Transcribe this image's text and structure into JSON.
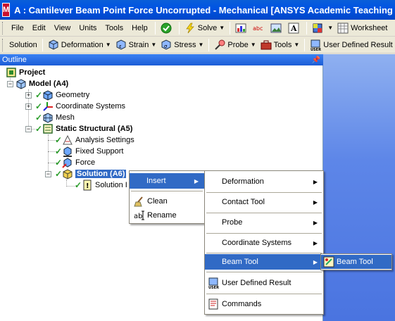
{
  "window": {
    "title": "A : Cantilever Beam Point Force Uncorrupted - Mechanical [ANSYS Academic Teaching A",
    "app_icon_letter": "M"
  },
  "menubar": {
    "items": [
      "File",
      "Edit",
      "View",
      "Units",
      "Tools",
      "Help"
    ],
    "solve_label": "Solve",
    "worksheet_label": "Worksheet"
  },
  "context_toolbar": {
    "solution_label": "Solution",
    "deformation_label": "Deformation",
    "strain_label": "Strain",
    "stress_label": "Stress",
    "probe_label": "Probe",
    "tools_label": "Tools",
    "user_defined_label": "User Defined Result"
  },
  "outline": {
    "header": "Outline",
    "project": "Project",
    "model": "Model (A4)",
    "geometry": "Geometry",
    "coordinate_systems": "Coordinate Systems",
    "mesh": "Mesh",
    "static_structural": "Static Structural (A5)",
    "analysis_settings": "Analysis Settings",
    "fixed_support": "Fixed Support",
    "force": "Force",
    "solution": "Solution (A6)",
    "solution_info": "Solution I"
  },
  "context_menu": {
    "insert": "Insert",
    "clean": "Clean",
    "rename": "Rename"
  },
  "insert_submenu": {
    "items": [
      "Deformation",
      "Contact Tool",
      "Probe",
      "Coordinate Systems",
      "Beam Tool",
      "User Defined Result",
      "Commands"
    ]
  },
  "beam_tool_submenu": {
    "item": "Beam Tool"
  },
  "colors": {
    "titlebar": "#0054e3",
    "highlight": "#316ac5",
    "check_green": "#2a9d2a",
    "menu_bg": "#ece9d8"
  }
}
